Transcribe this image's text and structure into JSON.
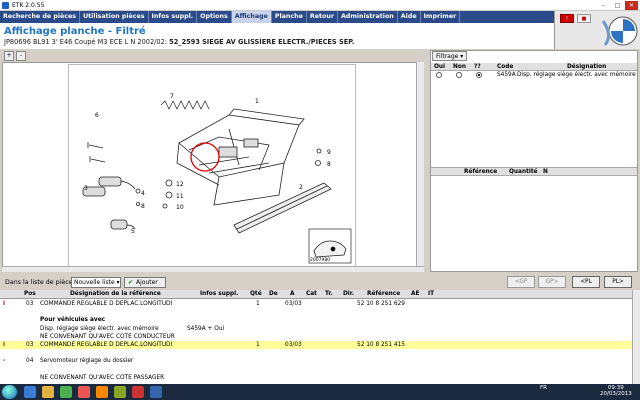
{
  "window": {
    "title": "ETK 2.0.55"
  },
  "menu": [
    "Recherche de pièces",
    "Utilisation pièces",
    "Infos suppl.",
    "Options",
    "Affichage",
    "Planche",
    "Retour",
    "Administration",
    "Aide",
    "Imprimer"
  ],
  "header": {
    "title": "Affichage planche - Filtré",
    "vehicle": "JP80696 BL91 3' E46 Coupé M3 ECE L N 2002/02:",
    "planche_code": "52_2593",
    "planche_name": "SIEGE AV GLISSIERE ELECTR./PIECES SEP."
  },
  "diagram": {
    "zoom_in": "+",
    "zoom_out": "-",
    "image_id": "2007980",
    "labels": [
      "1",
      "2",
      "3",
      "4",
      "5",
      "6",
      "7",
      "8",
      "9",
      "10",
      "11",
      "12"
    ]
  },
  "filter": {
    "button": "Filtrage",
    "columns": [
      "Oui",
      "Non",
      "??",
      "Code",
      "Désignation"
    ],
    "row": {
      "code": "S459A",
      "designation": "Disp. réglage siège électr. avec mémoire",
      "selected": "??"
    }
  },
  "ref_table": {
    "columns": [
      "Référence",
      "Quantité",
      "N"
    ]
  },
  "toolbar": {
    "label": "Dans la liste de pièces",
    "list_value": "Nouvelle liste",
    "add_button": "Ajouter",
    "nav": [
      "<GP",
      "GP>",
      "<PL",
      "PL>"
    ]
  },
  "parts": {
    "columns": [
      "Pos",
      "Désignation de la référence",
      "Infos suppl.",
      "Qté",
      "De",
      "A",
      "Cat",
      "Tr.",
      "Dir.",
      "Référence",
      "AE",
      "IT"
    ],
    "rows": [
      {
        "pos": "03",
        "desc": "COMMANDE REGLABLE D DEPLAC.LONGITUDI",
        "info": "",
        "qty": "1",
        "de": "",
        "a": "03/03",
        "ref": "52 10 8 251 629",
        "highlight": false,
        "icon": "i"
      },
      {
        "pos": "",
        "desc": "",
        "info": "",
        "qty": "",
        "de": "",
        "a": "",
        "ref": "",
        "highlight": false
      },
      {
        "pos": "",
        "desc": "Pour véhicules avec",
        "info": "",
        "qty": "",
        "de": "",
        "a": "",
        "ref": "",
        "highlight": false,
        "bold": true
      },
      {
        "pos": "",
        "desc": "Disp. réglage siège électr. avec mémoire",
        "info": "S459A + Oui",
        "qty": "",
        "de": "",
        "a": "",
        "ref": "",
        "highlight": false
      },
      {
        "pos": "",
        "desc": "NE CONVENANT QU'AVEC COTE CONDUCTEUR",
        "info": "",
        "qty": "",
        "de": "",
        "a": "",
        "ref": "",
        "highlight": false
      },
      {
        "pos": "03",
        "desc": "COMMANDE REGLABLE D DEPLAC.LONGITUDI",
        "info": "",
        "qty": "1",
        "de": "",
        "a": "03/03",
        "ref": "52 10 8 251 415",
        "highlight": true,
        "icon": "i"
      },
      {
        "pos": "",
        "desc": "",
        "info": "",
        "qty": "",
        "de": "",
        "a": "",
        "ref": "",
        "highlight": false
      },
      {
        "pos": "04",
        "desc": "Servomoteur réglage du dossier",
        "info": "",
        "qty": "",
        "de": "",
        "a": "",
        "ref": "",
        "highlight": false,
        "icon": "-"
      },
      {
        "pos": "",
        "desc": "",
        "info": "",
        "qty": "",
        "de": "",
        "a": "",
        "ref": "",
        "highlight": false
      },
      {
        "pos": "",
        "desc": "NE CONVENANT QU'AVEC COTE PASSAGER",
        "info": "",
        "qty": "",
        "de": "",
        "a": "",
        "ref": "",
        "highlight": false
      }
    ]
  },
  "taskbar": {
    "lang": "FR",
    "time": "09:39",
    "date": "20/03/2013"
  },
  "colors": {
    "menu_bg": "#2b4a8a",
    "title_blue": "#1f74c8",
    "highlight": "#ffff99"
  }
}
